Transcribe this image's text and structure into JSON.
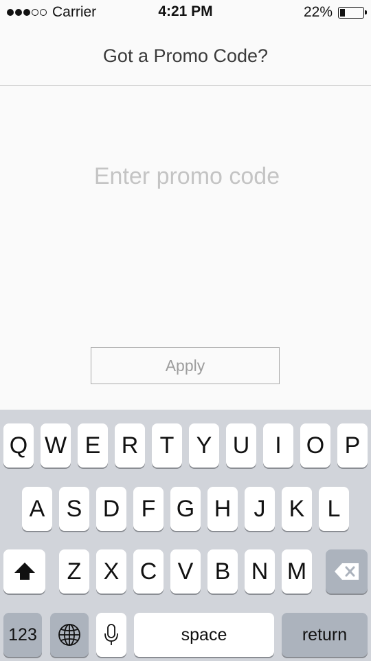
{
  "status_bar": {
    "carrier": "Carrier",
    "time": "4:21 PM",
    "battery_percent": "22%",
    "battery_level": 0.22,
    "signal_bars_filled": 3,
    "signal_bars_total": 5
  },
  "header": {
    "title": "Got a Promo Code?"
  },
  "promo": {
    "value": "",
    "placeholder": "Enter promo code"
  },
  "apply_button": {
    "label": "Apply"
  },
  "keyboard": {
    "row1": [
      "Q",
      "W",
      "E",
      "R",
      "T",
      "Y",
      "U",
      "I",
      "O",
      "P"
    ],
    "row2": [
      "A",
      "S",
      "D",
      "F",
      "G",
      "H",
      "J",
      "K",
      "L"
    ],
    "row3": [
      "Z",
      "X",
      "C",
      "V",
      "B",
      "N",
      "M"
    ],
    "numbers_key": "123",
    "space_key": "space",
    "return_key": "return",
    "shift_icon": "shift-icon",
    "delete_icon": "delete-icon",
    "globe_icon": "globe-icon",
    "mic_icon": "microphone-icon"
  }
}
